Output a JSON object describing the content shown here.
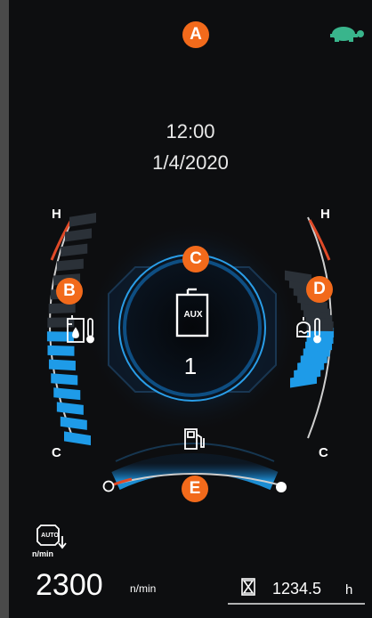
{
  "status": {
    "time": "12:00",
    "date": "1/4/2020",
    "turtle_icon": "turtle-icon",
    "turtle_color": "#39b58c"
  },
  "callouts": {
    "a": "A",
    "b": "B",
    "c": "C",
    "d": "D",
    "e": "E"
  },
  "left_gauge": {
    "icon": "hydraulic-oil-temperature-icon",
    "high_label": "H",
    "low_label": "C",
    "level": 0.5
  },
  "right_gauge": {
    "icon": "engine-coolant-temperature-icon",
    "high_label": "H",
    "low_label": "C",
    "level": 0.5
  },
  "center": {
    "mode_icon": "aux-tank-icon",
    "mode_label": "AUX",
    "mode_value": "1"
  },
  "fuel_gauge": {
    "icon": "fuel-pump-icon",
    "level": 0.55
  },
  "engine": {
    "icon": "auto-idle-engine-icon",
    "icon_label": "AUTO",
    "icon_unit": "n/min",
    "rpm": "2300",
    "rpm_unit": "n/min"
  },
  "hour_meter": {
    "icon": "hourglass-icon",
    "value": "1234.5",
    "unit": "h"
  },
  "colors": {
    "accent_blue": "#1e9be8",
    "warning_red": "#e04a28",
    "callout_orange": "#f26a1b",
    "background": "#0d0e10"
  }
}
